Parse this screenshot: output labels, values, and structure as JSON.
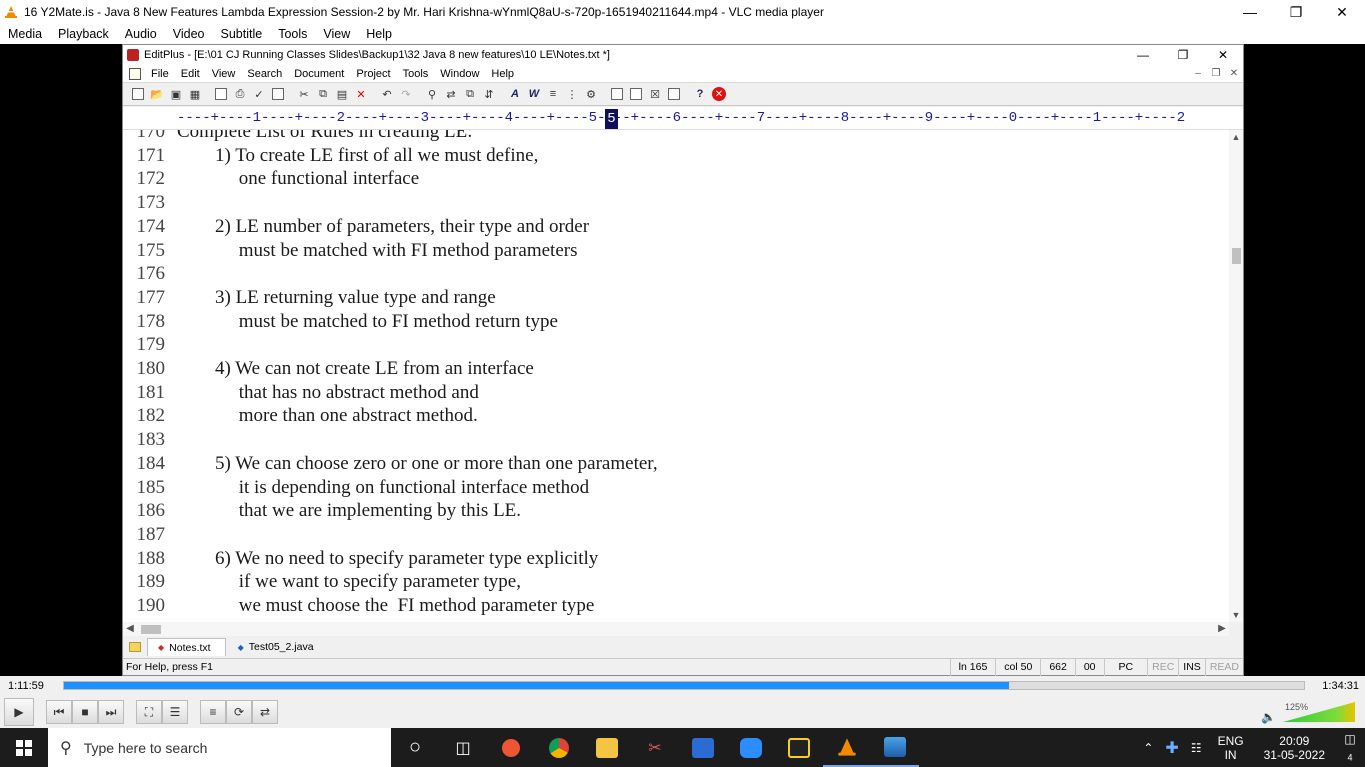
{
  "vlc": {
    "title": "16 Y2Mate.is - Java 8 New Features  Lambda Expression  Session-2  by Mr. Hari Krishna-wYnmlQ8aU-s-720p-1651940211644.mp4 - VLC media player",
    "menu": [
      "Media",
      "Playback",
      "Audio",
      "Video",
      "Subtitle",
      "Tools",
      "View",
      "Help"
    ],
    "time_elapsed": "1:11:59",
    "time_total": "1:34:31",
    "progress": 0.762,
    "volume": "125%"
  },
  "editplus": {
    "title": "EditPlus - [E:\\01 CJ Running Classes Slides\\Backup1\\32 Java 8 new features\\10 LE\\Notes.txt *]",
    "menu": [
      "File",
      "Edit",
      "View",
      "Search",
      "Document",
      "Project",
      "Tools",
      "Window",
      "Help"
    ],
    "ruler": "----+----1----+----2----+----3----+----4----+----5----+----6----+----7----+----8----+----9----+----0----+----1----+----2",
    "ruler_cursor": "5",
    "lines": [
      {
        "n": "170",
        "t": "Complete List of Rules in creating LE:"
      },
      {
        "n": "171",
        "t": "        1) To create LE first of all we must define,"
      },
      {
        "n": "172",
        "t": "             one functional interface"
      },
      {
        "n": "173",
        "t": ""
      },
      {
        "n": "174",
        "t": "        2) LE number of parameters, their type and order"
      },
      {
        "n": "175",
        "t": "             must be matched with FI method parameters"
      },
      {
        "n": "176",
        "t": ""
      },
      {
        "n": "177",
        "t": "        3) LE returning value type and range"
      },
      {
        "n": "178",
        "t": "             must be matched to FI method return type"
      },
      {
        "n": "179",
        "t": ""
      },
      {
        "n": "180",
        "t": "        4) We can not create LE from an interface"
      },
      {
        "n": "181",
        "t": "             that has no abstract method and"
      },
      {
        "n": "182",
        "t": "             more than one abstract method."
      },
      {
        "n": "183",
        "t": ""
      },
      {
        "n": "184",
        "t": "        5) We can choose zero or one or more than one parameter,"
      },
      {
        "n": "185",
        "t": "             it is depending on functional interface method"
      },
      {
        "n": "186",
        "t": "             that we are implementing by this LE."
      },
      {
        "n": "187",
        "t": ""
      },
      {
        "n": "188",
        "t": "        6) We no need to specify parameter type explicitly"
      },
      {
        "n": "189",
        "t": "             if we want to specify parameter type,"
      },
      {
        "n": "190",
        "t": "             we must choose the  FI method parameter type"
      }
    ],
    "tabs": [
      "Notes.txt",
      "Test05_2.java"
    ],
    "status": {
      "help": "For Help, press F1",
      "ln": "ln 165",
      "col": "col 50",
      "size": "662",
      "code": "00",
      "eol": "PC",
      "rec": "REC",
      "ins": "INS",
      "read": "READ"
    }
  },
  "taskbar": {
    "search_placeholder": "Type here to search",
    "lang_top": "ENG",
    "lang_bottom": "IN",
    "time": "20:09",
    "date": "31-05-2022",
    "notifications": "4"
  }
}
